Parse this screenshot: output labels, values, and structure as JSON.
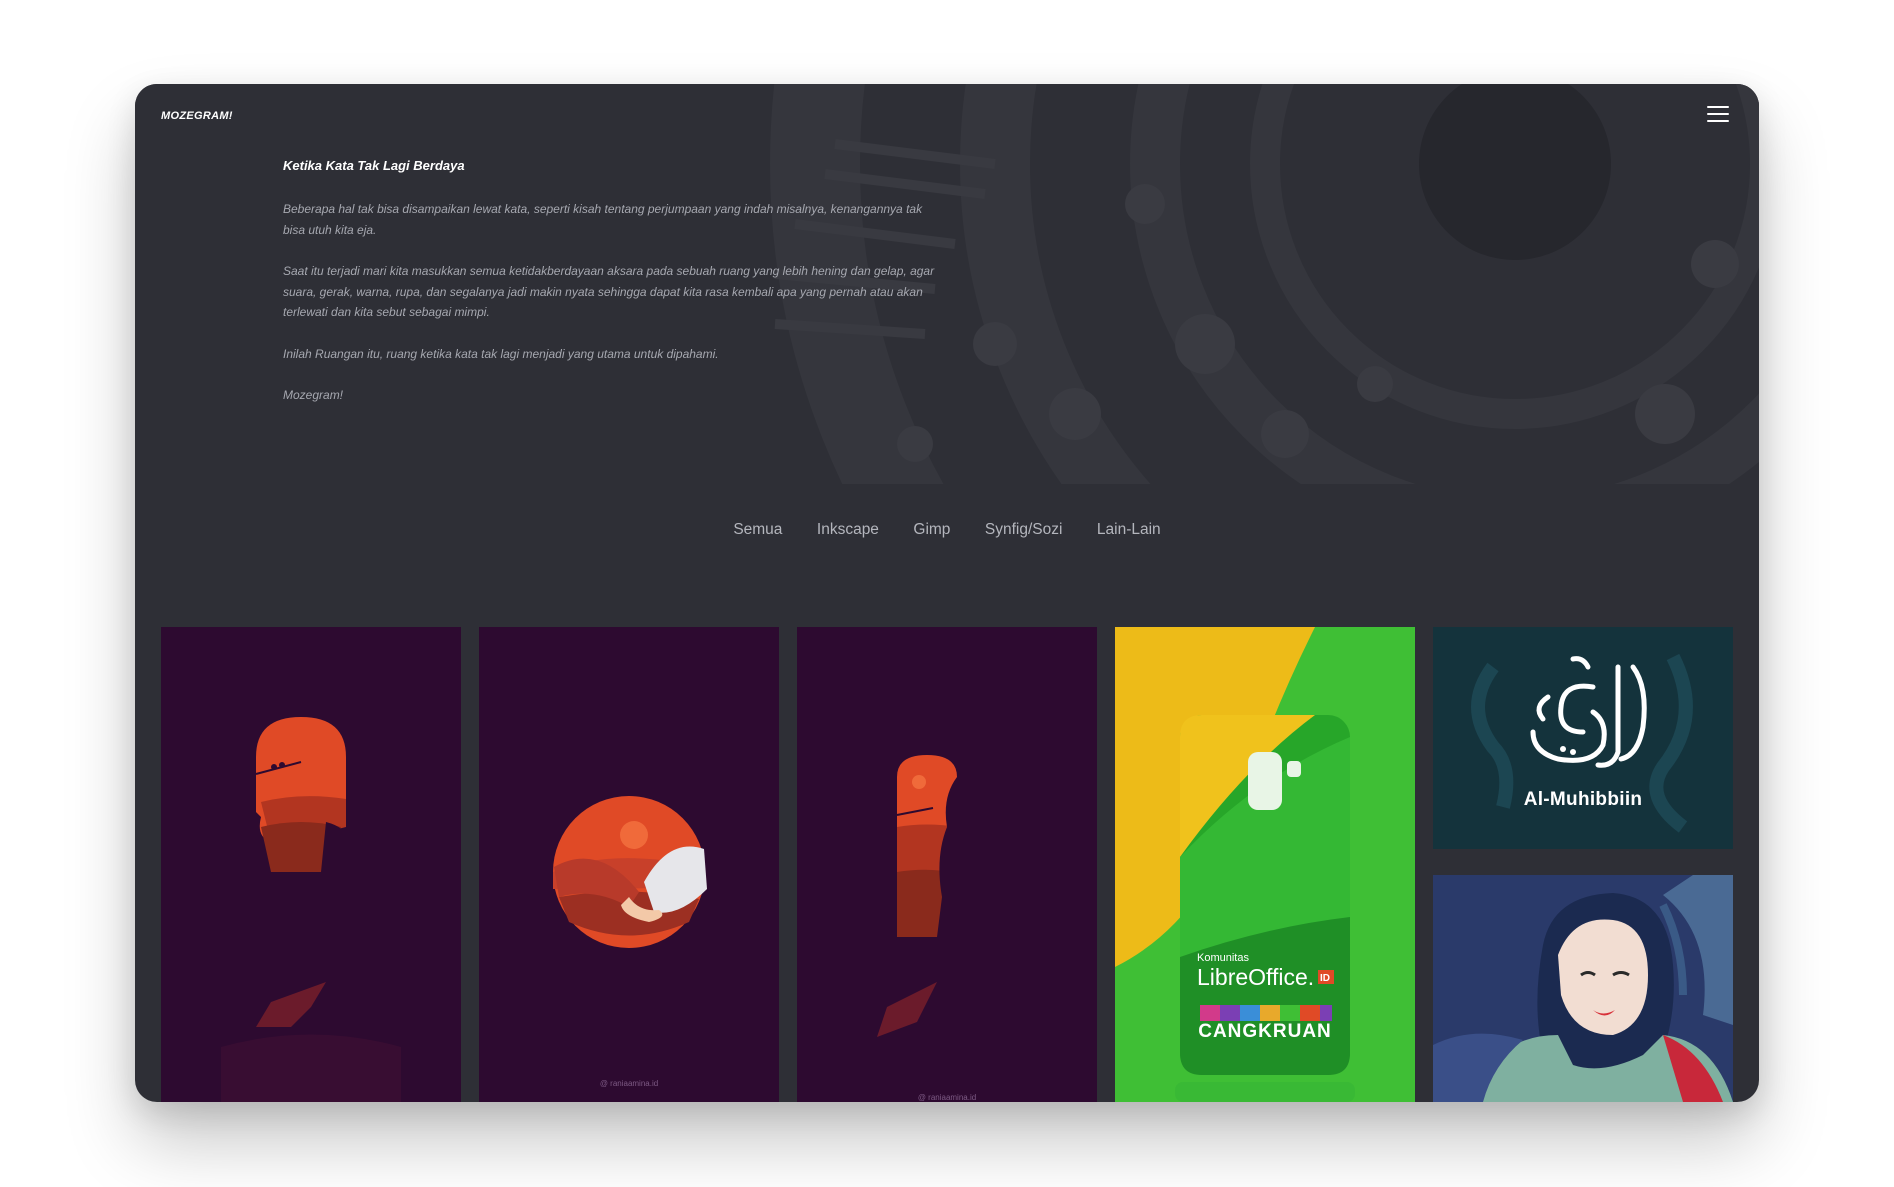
{
  "header": {
    "brand": "MOZEGRAM!",
    "menu_icon": "hamburger-menu-icon"
  },
  "intro": {
    "title": "Ketika Kata Tak Lagi Berdaya",
    "paragraphs": [
      "Beberapa hal tak bisa disampaikan lewat kata, seperti kisah tentang perjumpaan yang indah misalnya, kenangannya tak bisa utuh kita eja.",
      "Saat itu terjadi mari kita masukkan semua ketidakberdayaan aksara pada sebuah ruang yang lebih hening dan gelap, agar suara, gerak, warna, rupa, dan segalanya jadi makin nyata sehingga dapat kita rasa kembali apa yang pernah atau akan terlewati dan kita sebut sebagai mimpi.",
      "Inilah Ruangan itu, ruang ketika kata tak lagi menjadi yang utama untuk dipahami.",
      "Mozegram!"
    ]
  },
  "filters": [
    "Semua",
    "Inkscape",
    "Gimp",
    "Synfig/Sozi",
    "Lain-Lain"
  ],
  "gallery": {
    "items": [
      {
        "name": "couple-silhouette-sunset-illustration"
      },
      {
        "name": "holding-hands-illustration",
        "credit": "@ raniaamina.id"
      },
      {
        "name": "window-silhouette-illustration",
        "credit": "@ raniaamina.id"
      },
      {
        "name": "libreoffice-phone-case-design",
        "small": "Komunitas",
        "big": "LibreOffice.",
        "badge": "ID",
        "band": "CANGKRUAN"
      },
      {
        "name": "al-muhibbiin-calligraphy",
        "label": "Al-Muhibbiin"
      },
      {
        "name": "hijab-portrait-vector"
      }
    ]
  },
  "colors": {
    "frame": "#2e2f36",
    "purple_bg": "#2d0a30",
    "sunset": "#e04a26",
    "green": "#3fbf35",
    "yellow": "#edbb18",
    "teal": "#14333c",
    "navy": "#2a3a6a"
  }
}
